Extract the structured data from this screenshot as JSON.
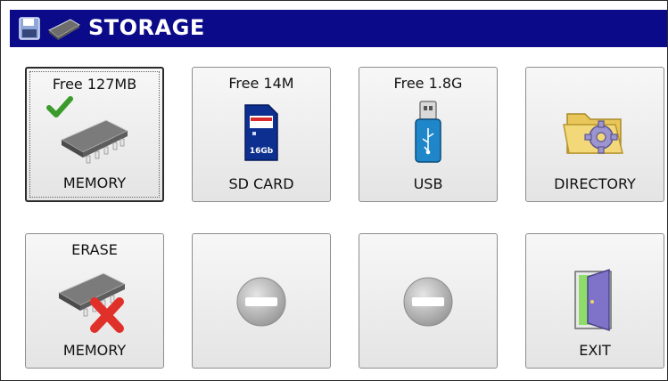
{
  "title": "STORAGE",
  "icons": {
    "title_left": "floppy-disk-icon",
    "title_chip": "memory-chip-icon"
  },
  "tiles": [
    {
      "top": "Free 127MB",
      "bottom": "MEMORY",
      "icon": "memory-chip-icon",
      "selected": true,
      "check": "green-check-icon"
    },
    {
      "top": "Free 14M",
      "bottom": "SD CARD",
      "icon": "sd-card-icon",
      "card_label": "16Gb"
    },
    {
      "top": "Free 1.8G",
      "bottom": "USB",
      "icon": "usb-drive-icon"
    },
    {
      "top": "",
      "bottom": "DIRECTORY",
      "icon": "folder-gear-icon"
    },
    {
      "top": "ERASE",
      "bottom": "MEMORY",
      "icon": "erase-memory-icon"
    },
    {
      "top": "",
      "bottom": "",
      "icon": "disabled-icon"
    },
    {
      "top": "",
      "bottom": "",
      "icon": "disabled-icon"
    },
    {
      "top": "",
      "bottom": "EXIT",
      "icon": "exit-door-icon"
    }
  ],
  "colors": {
    "titlebar": "#0b0b8a",
    "title_text": "#ffffff",
    "check": "#3a9a2a",
    "erase_x": "#e0302a",
    "usb": "#1f86c9",
    "sd": "#0d2f8f"
  }
}
